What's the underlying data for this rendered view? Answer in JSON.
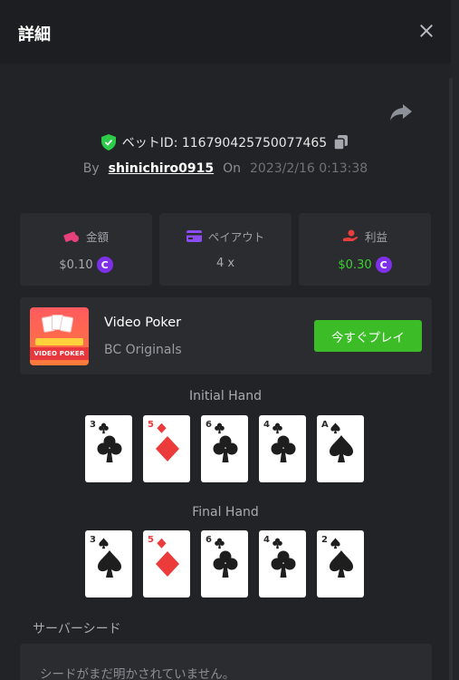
{
  "modal": {
    "title": "詳細"
  },
  "bet": {
    "id_label": "ベットID: 116790425750077465",
    "by_label": "By",
    "user": "shinichiro0915",
    "on_label": "On",
    "datetime": "2023/2/16 0:13:38"
  },
  "stats": [
    {
      "label": "金額",
      "value": "$0.10",
      "icon": "money-icon",
      "coin": true,
      "color": "#a7aab0"
    },
    {
      "label": "ペイアウト",
      "value": "4 x",
      "icon": "card-payout-icon",
      "coin": false,
      "color": "#a7aab0"
    },
    {
      "label": "利益",
      "value": "$0.30",
      "icon": "profit-hand-icon",
      "coin": true,
      "color": "#3bd12f"
    }
  ],
  "game": {
    "name": "Video Poker",
    "provider": "BC Originals",
    "thumb_label": "VIDEO POKER",
    "play_label": "今すぐプレイ"
  },
  "initial_hand": {
    "title": "Initial Hand",
    "cards": [
      {
        "rank": "3",
        "suit": "clubs"
      },
      {
        "rank": "5",
        "suit": "diamonds"
      },
      {
        "rank": "6",
        "suit": "clubs"
      },
      {
        "rank": "4",
        "suit": "clubs"
      },
      {
        "rank": "A",
        "suit": "spades"
      }
    ]
  },
  "final_hand": {
    "title": "Final Hand",
    "cards": [
      {
        "rank": "3",
        "suit": "spades"
      },
      {
        "rank": "5",
        "suit": "diamonds"
      },
      {
        "rank": "6",
        "suit": "clubs"
      },
      {
        "rank": "4",
        "suit": "clubs"
      },
      {
        "rank": "2",
        "suit": "spades"
      }
    ]
  },
  "seed": {
    "label": "サーバーシード",
    "text": "シードがまだ明かされていません。"
  },
  "colors": {
    "accent_green": "#3cbd28",
    "profit_green": "#3bd12f",
    "coin_purple": "#7e2fe8",
    "shield_green": "#2ecb4a"
  }
}
